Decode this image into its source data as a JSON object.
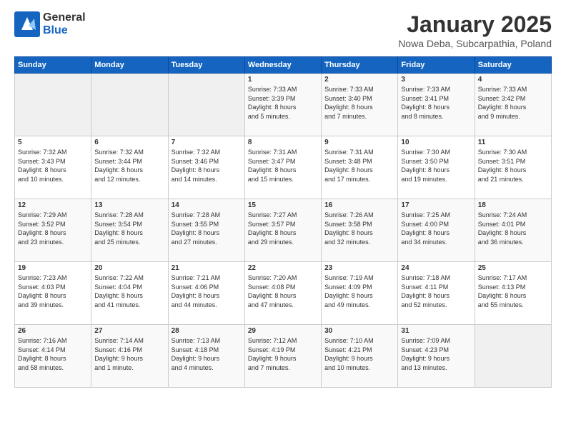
{
  "logo": {
    "general": "General",
    "blue": "Blue"
  },
  "title": "January 2025",
  "location": "Nowa Deba, Subcarpathia, Poland",
  "weekdays": [
    "Sunday",
    "Monday",
    "Tuesday",
    "Wednesday",
    "Thursday",
    "Friday",
    "Saturday"
  ],
  "weeks": [
    [
      {
        "day": "",
        "detail": ""
      },
      {
        "day": "",
        "detail": ""
      },
      {
        "day": "",
        "detail": ""
      },
      {
        "day": "1",
        "detail": "Sunrise: 7:33 AM\nSunset: 3:39 PM\nDaylight: 8 hours\nand 5 minutes."
      },
      {
        "day": "2",
        "detail": "Sunrise: 7:33 AM\nSunset: 3:40 PM\nDaylight: 8 hours\nand 7 minutes."
      },
      {
        "day": "3",
        "detail": "Sunrise: 7:33 AM\nSunset: 3:41 PM\nDaylight: 8 hours\nand 8 minutes."
      },
      {
        "day": "4",
        "detail": "Sunrise: 7:33 AM\nSunset: 3:42 PM\nDaylight: 8 hours\nand 9 minutes."
      }
    ],
    [
      {
        "day": "5",
        "detail": "Sunrise: 7:32 AM\nSunset: 3:43 PM\nDaylight: 8 hours\nand 10 minutes."
      },
      {
        "day": "6",
        "detail": "Sunrise: 7:32 AM\nSunset: 3:44 PM\nDaylight: 8 hours\nand 12 minutes."
      },
      {
        "day": "7",
        "detail": "Sunrise: 7:32 AM\nSunset: 3:46 PM\nDaylight: 8 hours\nand 14 minutes."
      },
      {
        "day": "8",
        "detail": "Sunrise: 7:31 AM\nSunset: 3:47 PM\nDaylight: 8 hours\nand 15 minutes."
      },
      {
        "day": "9",
        "detail": "Sunrise: 7:31 AM\nSunset: 3:48 PM\nDaylight: 8 hours\nand 17 minutes."
      },
      {
        "day": "10",
        "detail": "Sunrise: 7:30 AM\nSunset: 3:50 PM\nDaylight: 8 hours\nand 19 minutes."
      },
      {
        "day": "11",
        "detail": "Sunrise: 7:30 AM\nSunset: 3:51 PM\nDaylight: 8 hours\nand 21 minutes."
      }
    ],
    [
      {
        "day": "12",
        "detail": "Sunrise: 7:29 AM\nSunset: 3:52 PM\nDaylight: 8 hours\nand 23 minutes."
      },
      {
        "day": "13",
        "detail": "Sunrise: 7:28 AM\nSunset: 3:54 PM\nDaylight: 8 hours\nand 25 minutes."
      },
      {
        "day": "14",
        "detail": "Sunrise: 7:28 AM\nSunset: 3:55 PM\nDaylight: 8 hours\nand 27 minutes."
      },
      {
        "day": "15",
        "detail": "Sunrise: 7:27 AM\nSunset: 3:57 PM\nDaylight: 8 hours\nand 29 minutes."
      },
      {
        "day": "16",
        "detail": "Sunrise: 7:26 AM\nSunset: 3:58 PM\nDaylight: 8 hours\nand 32 minutes."
      },
      {
        "day": "17",
        "detail": "Sunrise: 7:25 AM\nSunset: 4:00 PM\nDaylight: 8 hours\nand 34 minutes."
      },
      {
        "day": "18",
        "detail": "Sunrise: 7:24 AM\nSunset: 4:01 PM\nDaylight: 8 hours\nand 36 minutes."
      }
    ],
    [
      {
        "day": "19",
        "detail": "Sunrise: 7:23 AM\nSunset: 4:03 PM\nDaylight: 8 hours\nand 39 minutes."
      },
      {
        "day": "20",
        "detail": "Sunrise: 7:22 AM\nSunset: 4:04 PM\nDaylight: 8 hours\nand 41 minutes."
      },
      {
        "day": "21",
        "detail": "Sunrise: 7:21 AM\nSunset: 4:06 PM\nDaylight: 8 hours\nand 44 minutes."
      },
      {
        "day": "22",
        "detail": "Sunrise: 7:20 AM\nSunset: 4:08 PM\nDaylight: 8 hours\nand 47 minutes."
      },
      {
        "day": "23",
        "detail": "Sunrise: 7:19 AM\nSunset: 4:09 PM\nDaylight: 8 hours\nand 49 minutes."
      },
      {
        "day": "24",
        "detail": "Sunrise: 7:18 AM\nSunset: 4:11 PM\nDaylight: 8 hours\nand 52 minutes."
      },
      {
        "day": "25",
        "detail": "Sunrise: 7:17 AM\nSunset: 4:13 PM\nDaylight: 8 hours\nand 55 minutes."
      }
    ],
    [
      {
        "day": "26",
        "detail": "Sunrise: 7:16 AM\nSunset: 4:14 PM\nDaylight: 8 hours\nand 58 minutes."
      },
      {
        "day": "27",
        "detail": "Sunrise: 7:14 AM\nSunset: 4:16 PM\nDaylight: 9 hours\nand 1 minute."
      },
      {
        "day": "28",
        "detail": "Sunrise: 7:13 AM\nSunset: 4:18 PM\nDaylight: 9 hours\nand 4 minutes."
      },
      {
        "day": "29",
        "detail": "Sunrise: 7:12 AM\nSunset: 4:19 PM\nDaylight: 9 hours\nand 7 minutes."
      },
      {
        "day": "30",
        "detail": "Sunrise: 7:10 AM\nSunset: 4:21 PM\nDaylight: 9 hours\nand 10 minutes."
      },
      {
        "day": "31",
        "detail": "Sunrise: 7:09 AM\nSunset: 4:23 PM\nDaylight: 9 hours\nand 13 minutes."
      },
      {
        "day": "",
        "detail": ""
      }
    ]
  ]
}
